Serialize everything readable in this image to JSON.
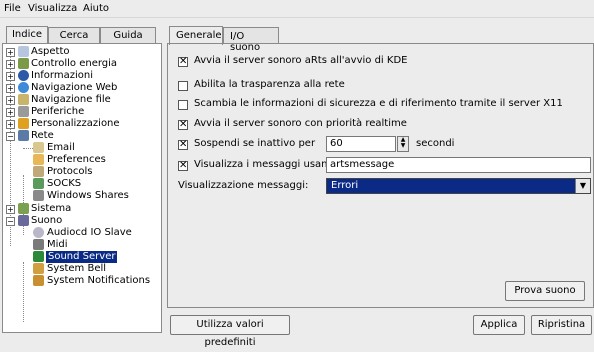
{
  "menu": {
    "file": "File",
    "view": "Visualizza",
    "help": "Aiuto"
  },
  "left_tabs": {
    "index": "Indice",
    "search": "Cerca",
    "guide": "Guida"
  },
  "tree": {
    "aspetto": "Aspetto",
    "energia": "Controllo energia",
    "informazioni": "Informazioni",
    "navweb": "Navigazione Web",
    "navfile": "Navigazione file",
    "periferiche": "Periferiche",
    "personalizzazione": "Personalizzazione",
    "rete": "Rete",
    "email": "Email",
    "preferences": "Preferences",
    "protocols": "Protocols",
    "socks": "SOCKS",
    "windows_shares": "Windows Shares",
    "sistema": "Sistema",
    "suono": "Suono",
    "audiocd": "Audiocd IO Slave",
    "midi": "Midi",
    "sound_server": "Sound Server",
    "system_bell": "System Bell",
    "system_notifications": "System Notifications"
  },
  "tabs": {
    "generale": "Generale",
    "io_suono": "I/O suono"
  },
  "options": {
    "start_server": "Avvia il server sonoro aRts all'avvio di KDE",
    "transparency": "Abilita la trasparenza alla rete",
    "exchange_security": "Scambia le informazioni di sicurezza e di riferimento tramite il server X11",
    "realtime": "Avvia il server sonoro con priorità realtime",
    "suspend": "Sospendi se inattivo per",
    "suspend_value": "60",
    "suspend_unit": "secondi",
    "show_messages": "Visualizza i messaggi usando:",
    "messages_app": "artsmessage",
    "messages_display_label": "Visualizzazione messaggi:",
    "messages_display_value": "Errori"
  },
  "buttons": {
    "test_sound": "Prova suono",
    "defaults": "Utilizza valori predefiniti",
    "apply": "Applica",
    "reset": "Ripristina"
  },
  "colors": {
    "selection": "#0a2a85",
    "background": "#ececec"
  }
}
